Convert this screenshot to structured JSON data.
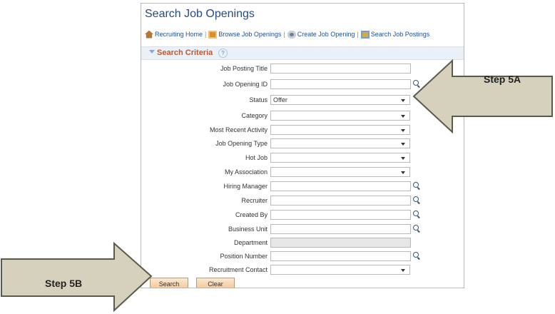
{
  "page": {
    "title": "Search Job Openings"
  },
  "toolbar": {
    "items": [
      {
        "label": "Recruiting Home",
        "icon": "home-icon"
      },
      {
        "label": "Browse Job Openings",
        "icon": "browse-icon"
      },
      {
        "label": "Create Job Opening",
        "icon": "create-icon"
      },
      {
        "label": "Search Job Postings",
        "icon": "postings-icon"
      }
    ],
    "separator": "|"
  },
  "section": {
    "label": "Search Criteria",
    "help": "?"
  },
  "fields": [
    {
      "label": "Job Posting Title",
      "value": "",
      "type": "text"
    },
    {
      "label": "Job Opening ID",
      "value": "",
      "type": "lookup"
    },
    {
      "label": "Status",
      "value": "Offer",
      "type": "dropdown"
    },
    {
      "label": "Category",
      "value": "",
      "type": "dropdown"
    },
    {
      "label": "Most Recent Activity",
      "value": "",
      "type": "dropdown"
    },
    {
      "label": "Job Opening Type",
      "value": "",
      "type": "dropdown"
    },
    {
      "label": "Hot Job",
      "value": "",
      "type": "dropdown"
    },
    {
      "label": "My Association",
      "value": "",
      "type": "dropdown"
    },
    {
      "label": "Hiring Manager",
      "value": "",
      "type": "lookup"
    },
    {
      "label": "Recruiter",
      "value": "",
      "type": "lookup"
    },
    {
      "label": "Created By",
      "value": "",
      "type": "lookup"
    },
    {
      "label": "Business Unit",
      "value": "",
      "type": "lookup"
    },
    {
      "label": "Department",
      "value": "",
      "type": "disabled"
    },
    {
      "label": "Position Number",
      "value": "",
      "type": "lookup"
    },
    {
      "label": "Recruitment Contact",
      "value": "",
      "type": "dropdown"
    }
  ],
  "buttons": {
    "search": "Search",
    "clear": "Clear"
  },
  "callouts": {
    "step5a": "Step 5A",
    "step5b": "Step 5B",
    "fill_color": "#d6d1bd",
    "stroke_color": "#5b5a4a"
  },
  "colors": {
    "title": "#264b86",
    "section_label": "#c0562a",
    "link": "#1d4f96"
  }
}
